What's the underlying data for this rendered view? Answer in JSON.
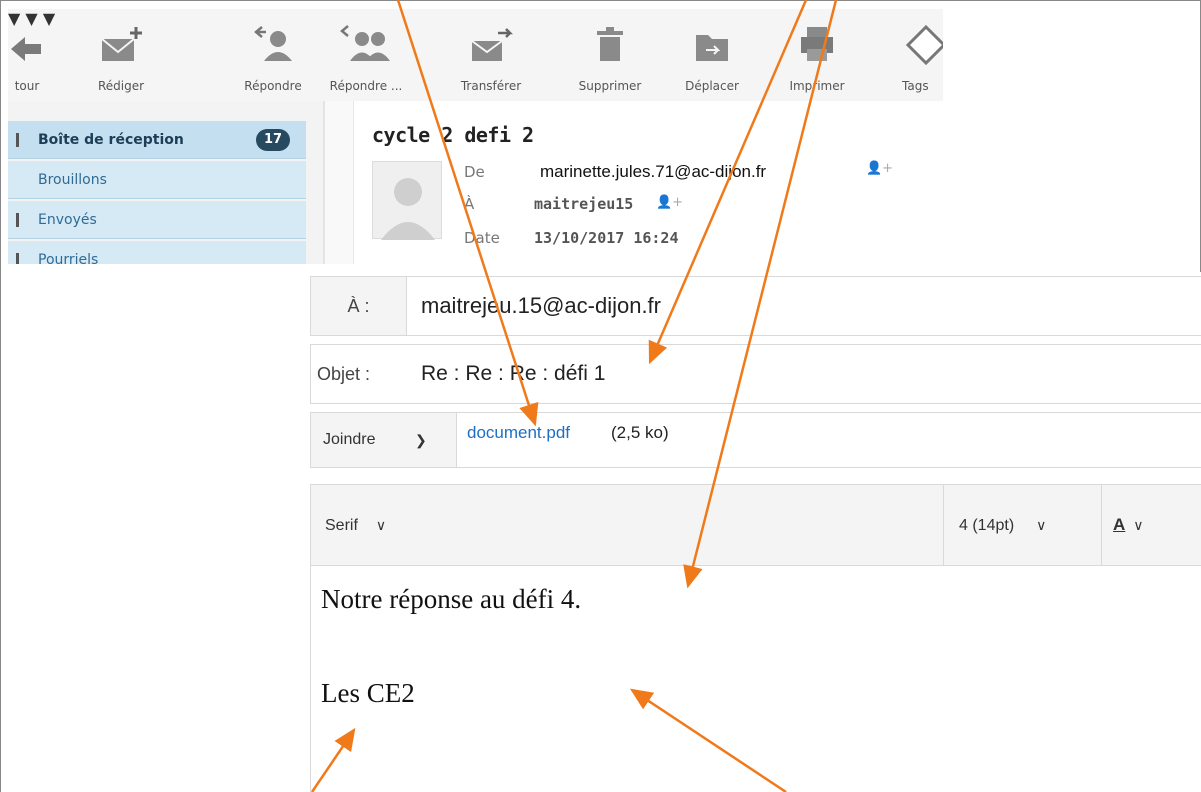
{
  "toolbar": {
    "items": [
      {
        "label": "tour",
        "icon": "arrow-left-icon"
      },
      {
        "label": "Rédiger",
        "icon": "compose-envelope-icon"
      },
      {
        "label": "Répondre",
        "icon": "reply-icon"
      },
      {
        "label": "Répondre ...",
        "icon": "reply-all-icon"
      },
      {
        "label": "Transférer",
        "icon": "forward-icon"
      },
      {
        "label": "Supprimer",
        "icon": "trash-icon"
      },
      {
        "label": "Déplacer",
        "icon": "move-folder-icon"
      },
      {
        "label": "Imprimer",
        "icon": "print-icon"
      },
      {
        "label": "Tags",
        "icon": "tag-icon"
      }
    ]
  },
  "folders": {
    "items": [
      {
        "label": "Boîte de réception",
        "count": "17"
      },
      {
        "label": "Brouillons"
      },
      {
        "label": "Envoyés"
      },
      {
        "label": "Pourriels"
      }
    ]
  },
  "message": {
    "subject": "cycle 2 defi 2",
    "from_label": "De",
    "from_value": "marinette.jules.71@ac-dijon.fr",
    "to_label": "À",
    "to_value": "maitrejeu15",
    "date_label": "Date",
    "date_value": "13/10/2017 16:24"
  },
  "composer": {
    "to_label": "À :",
    "to_value": "maitrejeu.15@ac-dijon.fr",
    "subject_label": "Objet :",
    "subject_value": "Re : Re : Re : défi 1",
    "attach_label": "Joindre",
    "attachment_name": "document.pdf",
    "attachment_size": "(2,5 ko)",
    "font_family": "Serif",
    "font_size": "4 (14pt)",
    "color_button": "A",
    "body_line1": "Notre réponse au défi 4.",
    "body_line2": "Les CE2"
  },
  "colors": {
    "arrow": "#f07a1a",
    "folder_bg": "#d6eaf5",
    "badge_bg": "#274a61",
    "link": "#1d6fc6"
  }
}
